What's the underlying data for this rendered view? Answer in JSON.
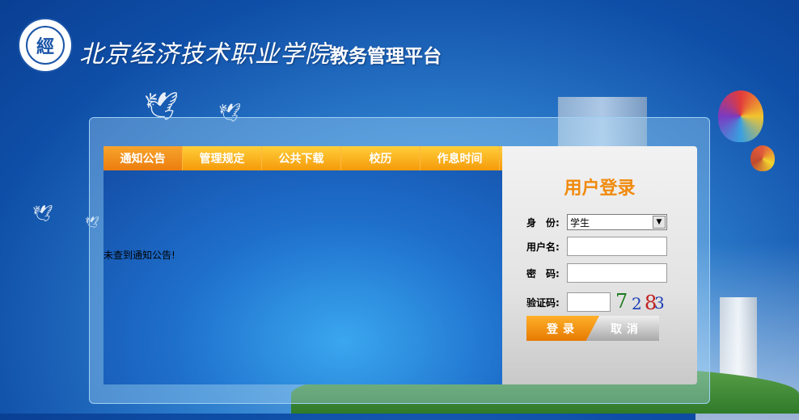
{
  "header": {
    "logo_glyph": "經",
    "school_name": "北京经济技术职业学院",
    "platform_name": "教务管理平台"
  },
  "tabs": [
    {
      "label": "通知公告",
      "active": true
    },
    {
      "label": "管理规定",
      "active": false
    },
    {
      "label": "公共下载",
      "active": false
    },
    {
      "label": "校历",
      "active": false
    },
    {
      "label": "作息时间",
      "active": false
    }
  ],
  "notice": {
    "empty_text": "未查到通知公告!"
  },
  "login": {
    "title": "用户登录",
    "identity_label": "身　份:",
    "identity_value": "学生",
    "username_label": "用户名:",
    "password_label": "密　码:",
    "captcha_label": "验证码:",
    "captcha_chars": [
      "7",
      "2",
      "8",
      "3"
    ],
    "login_button": "登录",
    "cancel_button": "取消"
  },
  "colors": {
    "accent": "#f08a0c",
    "tab_bar": "#f59a0a",
    "background": "#2f80cf"
  }
}
